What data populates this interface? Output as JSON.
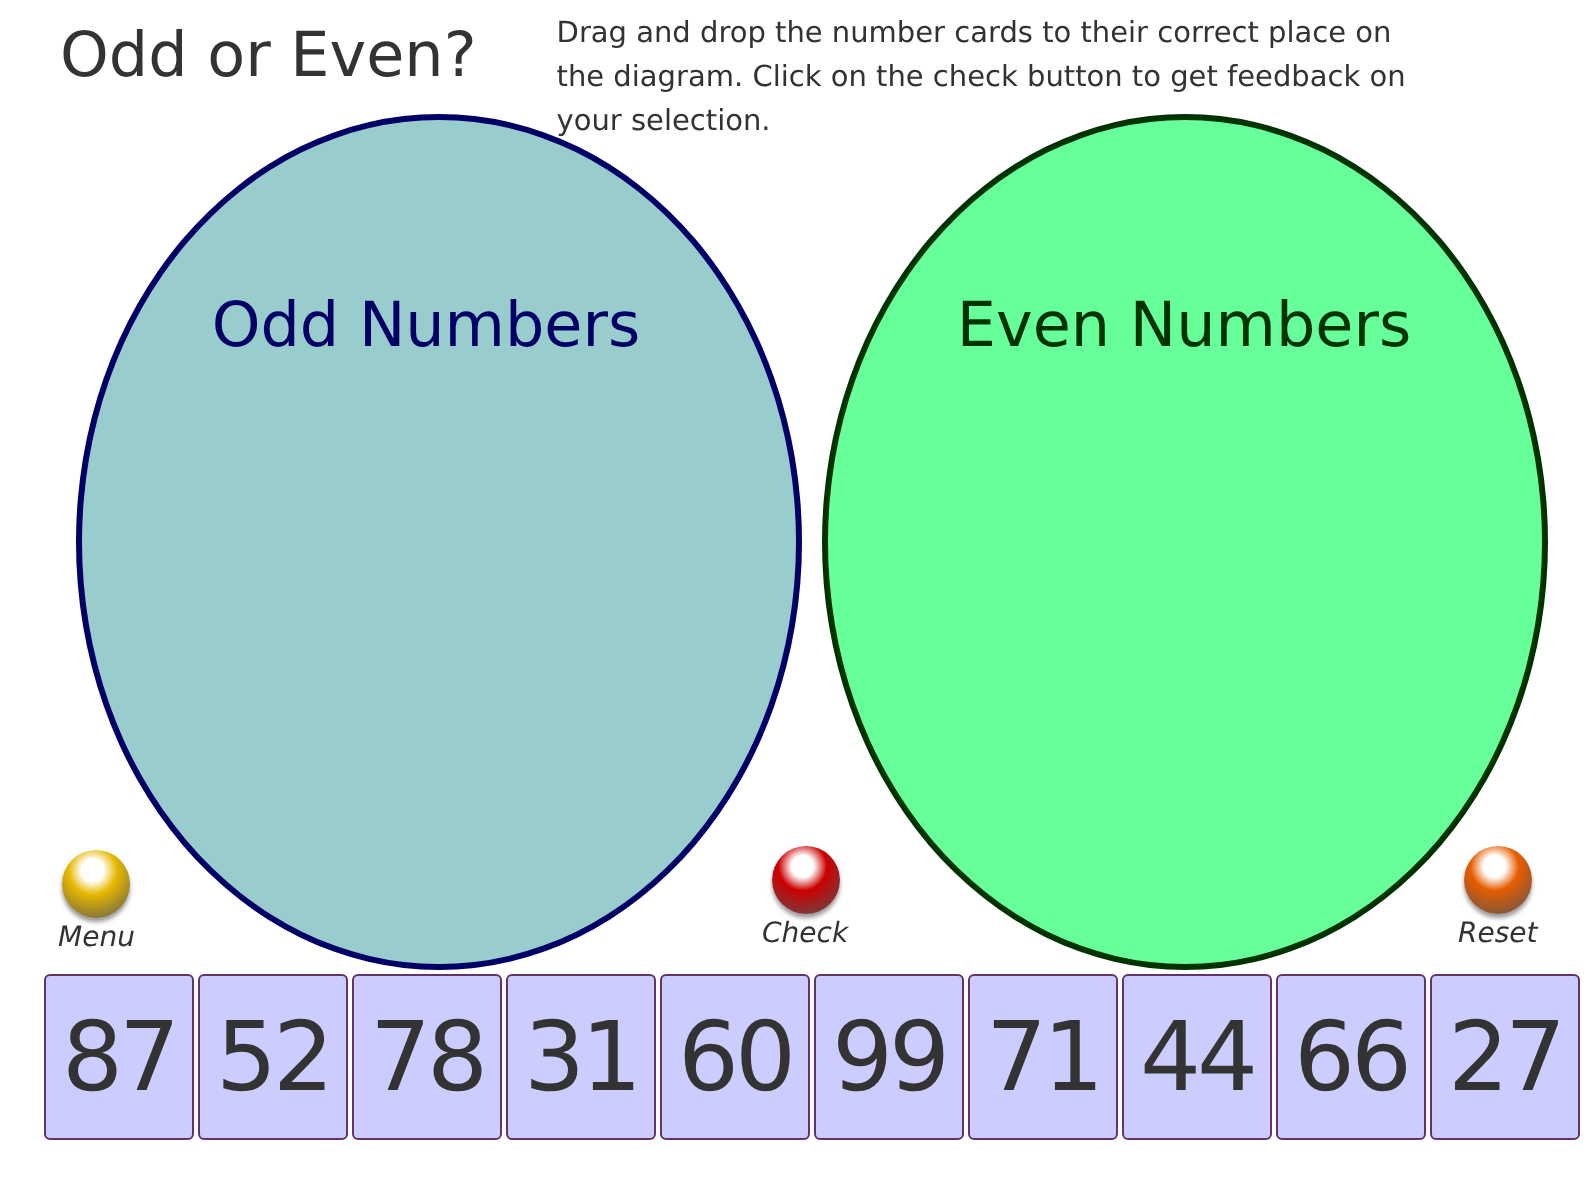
{
  "title": "Odd or Even?",
  "instructions": "Drag and drop the number cards to their correct place on the diagram. Click on the check button to get feedback on your selection.",
  "sets": [
    {
      "kind": "odd",
      "label": "Odd Numbers",
      "color": "#99cccc"
    },
    {
      "kind": "even",
      "label": "Even Numbers",
      "color": "#66ff99"
    }
  ],
  "buttons": [
    {
      "label": "Menu",
      "color": "#e6b800"
    },
    {
      "label": "Check",
      "color": "#cc0000"
    },
    {
      "label": "Reset",
      "color": "#e65c00"
    }
  ],
  "cards": [
    "87",
    "52",
    "78",
    "31",
    "60",
    "99",
    "71",
    "44",
    "66",
    "27"
  ]
}
